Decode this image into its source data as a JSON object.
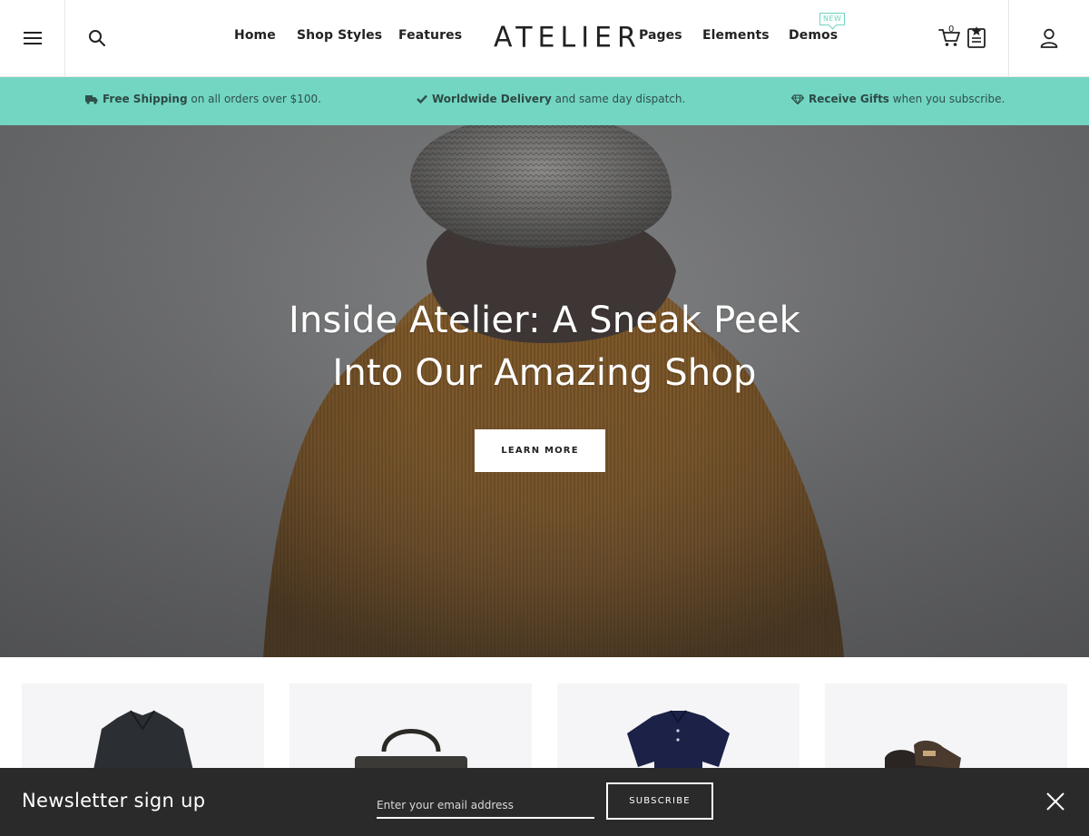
{
  "header": {
    "logo": "ATELIER",
    "nav": [
      "Home",
      "Shop Styles",
      "Features",
      "Pages",
      "Elements",
      "Demos"
    ],
    "new_badge": "NEW",
    "cart_count": "0"
  },
  "banner": [
    {
      "bold": "Free Shipping",
      "rest": "on all orders over $100.",
      "icon": "truck-icon"
    },
    {
      "bold": "Worldwide Delivery",
      "rest": "and same day dispatch.",
      "icon": "check-icon"
    },
    {
      "bold": "Receive Gifts",
      "rest": "when you subscribe.",
      "icon": "diamond-icon"
    }
  ],
  "hero": {
    "title_line1": "Inside Atelier: A Sneak Peek",
    "title_line2": "Into Our Amazing Shop",
    "button": "LEARN MORE"
  },
  "products": [
    {
      "name": "jacket"
    },
    {
      "name": "bag"
    },
    {
      "name": "polo-shirt"
    },
    {
      "name": "shoes"
    }
  ],
  "newsletter": {
    "title": "Newsletter sign up",
    "placeholder": "Enter your email address",
    "button": "SUBSCRIBE"
  },
  "colors": {
    "accent": "#72d6c2",
    "dark": "#2a2a2a"
  }
}
